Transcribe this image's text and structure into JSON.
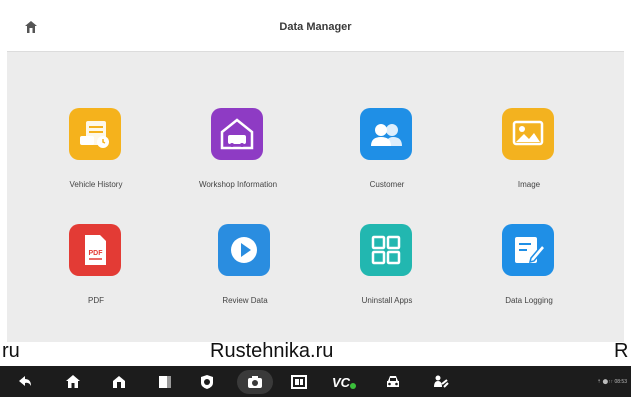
{
  "header": {
    "title": "Data Manager"
  },
  "tiles": [
    {
      "label": "Vehicle History",
      "icon": "vehicle-history-icon",
      "color": "#f5b21c"
    },
    {
      "label": "Workshop Information",
      "icon": "workshop-icon",
      "color": "#8e3bc4"
    },
    {
      "label": "Customer",
      "icon": "customer-icon",
      "color": "#1f8fe6"
    },
    {
      "label": "Image",
      "icon": "image-icon",
      "color": "#f3b21f"
    },
    {
      "label": "PDF",
      "icon": "pdf-icon",
      "color": "#e33b35"
    },
    {
      "label": "Review Data",
      "icon": "review-data-icon",
      "color": "#2a8de0"
    },
    {
      "label": "Uninstall Apps",
      "icon": "uninstall-apps-icon",
      "color": "#22b7b0"
    },
    {
      "label": "Data Logging",
      "icon": "data-logging-icon",
      "color": "#1f8fe6"
    }
  ],
  "watermark": {
    "left": "ru",
    "center": "Rustehnika.ru",
    "right": "R"
  },
  "navbar": {
    "icons": [
      "back-icon",
      "home-icon",
      "launcher-icon",
      "recent-apps-icon",
      "browser-icon",
      "camera-icon",
      "screen-mirror-icon",
      "vci-icon",
      "vehicle-icon",
      "remote-support-icon"
    ],
    "status": "⇡ ⬤↑↑ 08:53"
  }
}
